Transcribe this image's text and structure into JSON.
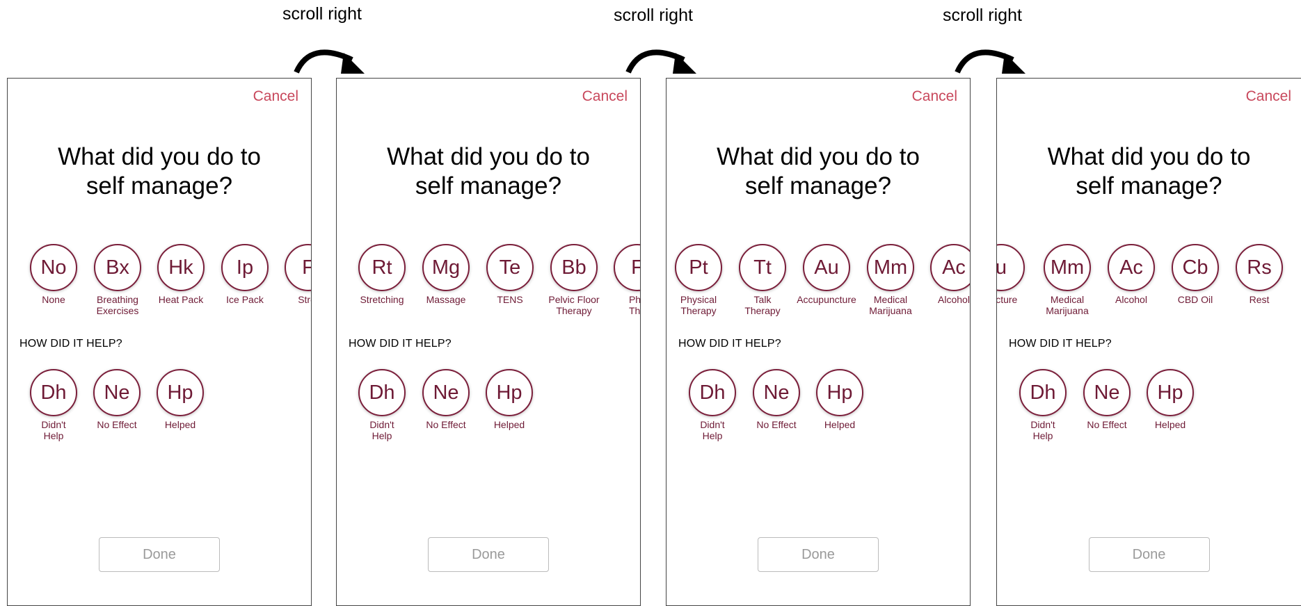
{
  "scroll_labels": [
    "scroll right",
    "scroll right",
    "scroll right"
  ],
  "panels": [
    {
      "cancel": "Cancel",
      "title_line1": "What did you do to",
      "title_line2": "self manage?",
      "options": [
        {
          "abbr": "No",
          "label": "None"
        },
        {
          "abbr": "Bx",
          "label": "Breathing\nExercises"
        },
        {
          "abbr": "Hk",
          "label": "Heat Pack"
        },
        {
          "abbr": "Ip",
          "label": "Ice Pack"
        },
        {
          "abbr": "F",
          "label": "Stret"
        }
      ],
      "section": "HOW DID IT HELP?",
      "effects": [
        {
          "abbr": "Dh",
          "label": "Didn't\nHelp"
        },
        {
          "abbr": "Ne",
          "label": "No Effect"
        },
        {
          "abbr": "Hp",
          "label": "Helped"
        }
      ],
      "done": "Done"
    },
    {
      "cancel": "Cancel",
      "title_line1": "What did you do to",
      "title_line2": "self manage?",
      "options": [
        {
          "abbr": "Rt",
          "label": "Stretching"
        },
        {
          "abbr": "Mg",
          "label": "Massage"
        },
        {
          "abbr": "Te",
          "label": "TENS"
        },
        {
          "abbr": "Bb",
          "label": "Pelvic Floor\nTherapy"
        },
        {
          "abbr": "F",
          "label": "Phy\nThe"
        }
      ],
      "section": "HOW DID IT HELP?",
      "effects": [
        {
          "abbr": "Dh",
          "label": "Didn't\nHelp"
        },
        {
          "abbr": "Ne",
          "label": "No Effect"
        },
        {
          "abbr": "Hp",
          "label": "Helped"
        }
      ],
      "done": "Done"
    },
    {
      "cancel": "Cancel",
      "title_line1": "What did you do to",
      "title_line2": "self manage?",
      "options": [
        {
          "abbr": "Pt",
          "label": "Physical\nTherapy"
        },
        {
          "abbr": "Tt",
          "label": "Talk\nTherapy"
        },
        {
          "abbr": "Au",
          "label": "Accupuncture"
        },
        {
          "abbr": "Mm",
          "label": "Medical\nMarijuana"
        },
        {
          "abbr": "Ac",
          "label": "Alcohol"
        }
      ],
      "section": "HOW DID IT HELP?",
      "effects": [
        {
          "abbr": "Dh",
          "label": "Didn't\nHelp"
        },
        {
          "abbr": "Ne",
          "label": "No Effect"
        },
        {
          "abbr": "Hp",
          "label": "Helped"
        }
      ],
      "done": "Done"
    },
    {
      "cancel": "Cancel",
      "title_line1": "What did you do to",
      "title_line2": "self manage?",
      "options": [
        {
          "abbr": "u",
          "label": "uncture"
        },
        {
          "abbr": "Mm",
          "label": "Medical\nMarijuana"
        },
        {
          "abbr": "Ac",
          "label": "Alcohol"
        },
        {
          "abbr": "Cb",
          "label": "CBD Oil"
        },
        {
          "abbr": "Rs",
          "label": "Rest"
        }
      ],
      "section": "HOW DID IT HELP?",
      "effects": [
        {
          "abbr": "Dh",
          "label": "Didn't\nHelp"
        },
        {
          "abbr": "Ne",
          "label": "No Effect"
        },
        {
          "abbr": "Hp",
          "label": "Helped"
        }
      ],
      "done": "Done"
    }
  ]
}
